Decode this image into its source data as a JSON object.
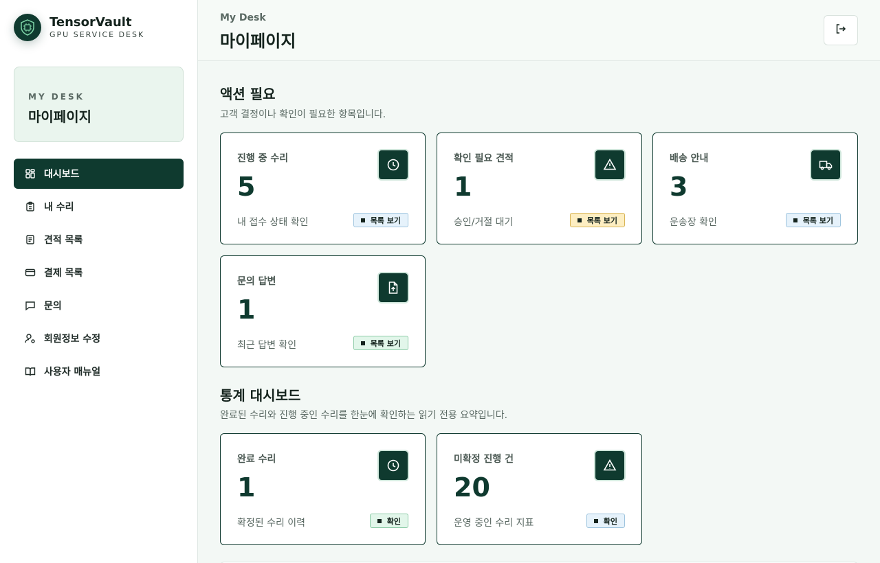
{
  "brand": {
    "name": "TensorVault",
    "subtitle": "GPU SERVICE DESK"
  },
  "profile": {
    "kicker": "MY DESK",
    "title": "마이페이지"
  },
  "nav": {
    "items": [
      {
        "label": "대시보드",
        "icon": "dashboard-icon",
        "active": true
      },
      {
        "label": "내 수리",
        "icon": "clipboard-icon"
      },
      {
        "label": "견적 목록",
        "icon": "document-icon"
      },
      {
        "label": "결제 목록",
        "icon": "credit-card-icon"
      },
      {
        "label": "문의",
        "icon": "chat-icon"
      },
      {
        "label": "회원정보 수정",
        "icon": "user-settings-icon"
      },
      {
        "label": "사용자 매뉴얼",
        "icon": "book-icon"
      }
    ]
  },
  "header": {
    "kicker": "My Desk",
    "title": "마이페이지",
    "logout_icon": "logout-icon"
  },
  "action_section": {
    "title": "액션 필요",
    "description": "고객 결정이나 확인이 필요한 항목입니다.",
    "cards": [
      {
        "label": "진행 중 수리",
        "value": "5",
        "desc": "내 접수 상태 확인",
        "badge": "목록 보기",
        "badge_color": "#e6f2fb",
        "icon": "clock-icon"
      },
      {
        "label": "확인 필요 견적",
        "value": "1",
        "desc": "승인/거절 대기",
        "badge": "목록 보기",
        "badge_color": "#fdeec2",
        "icon": "warning-icon"
      },
      {
        "label": "배송 안내",
        "value": "3",
        "desc": "운송장 확인",
        "badge": "목록 보기",
        "badge_color": "#e6f2fb",
        "icon": "truck-icon"
      },
      {
        "label": "문의 답변",
        "value": "1",
        "desc": "최근 답변 확인",
        "badge": "목록 보기",
        "badge_color": "#e2f6ea",
        "icon": "file-upload-icon"
      }
    ]
  },
  "stats_section": {
    "title": "통계 대시보드",
    "description": "완료된 수리와 진행 중인 수리를 한눈에 확인하는 읽기 전용 요약입니다.",
    "cards": [
      {
        "label": "완료 수리",
        "value": "1",
        "desc": "확정된 수리 이력",
        "badge": "확인",
        "badge_color": "#e2f6ea",
        "icon": "clock-icon"
      },
      {
        "label": "미확정 진행 건",
        "value": "20",
        "desc": "운영 중인 수리 지표",
        "badge": "확인",
        "badge_color": "#e6f2fb",
        "icon": "warning-icon"
      }
    ]
  },
  "colors": {
    "primary": "#0f3a2f",
    "background": "#f3f8f5",
    "text": "#14231d",
    "muted": "#5b6a64"
  }
}
